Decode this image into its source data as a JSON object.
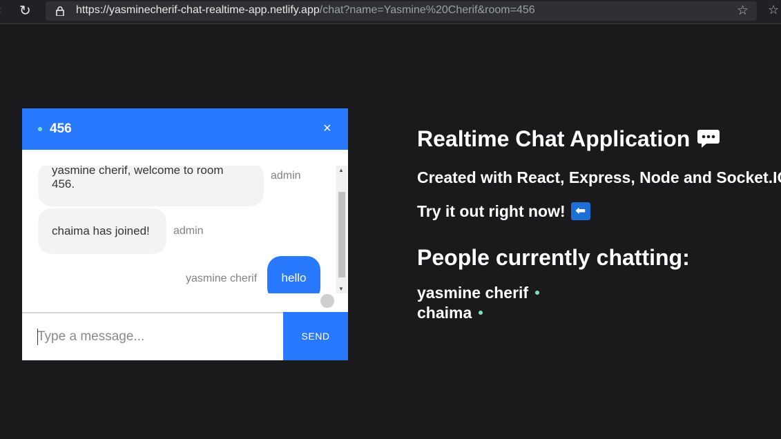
{
  "browser": {
    "url_base": "https://yasminecherif-chat-realtime-app.netlify.app",
    "url_path": "/chat?name=Yasmine%20Cherif&room=456"
  },
  "chat": {
    "room": "456",
    "close_label": "×",
    "messages": [
      {
        "text": "yasmine cherif, welcome to room 456.",
        "user": "admin",
        "own": false
      },
      {
        "text": "chaima has joined!",
        "user": "admin",
        "own": false
      },
      {
        "text": "hello",
        "user": "yasmine cherif",
        "own": true
      }
    ],
    "input": {
      "value": "",
      "placeholder": "Type a message..."
    },
    "send_label": "SEND",
    "colors": {
      "accent": "#2979ff",
      "online": "#7ee2b8",
      "bubble": "#f3f3f3"
    }
  },
  "info": {
    "title": "Realtime Chat Application",
    "subtitle": "Created with React, Express, Node and Socket.IO",
    "cta": "Try it out right now!",
    "title_icon": "speech-balloon-icon",
    "cta_icon": "left-arrow-icon",
    "people_heading": "People currently chatting:",
    "people": [
      "yasmine cherif",
      "chaima"
    ]
  },
  "colors": {
    "background": "#1a1a1d"
  }
}
